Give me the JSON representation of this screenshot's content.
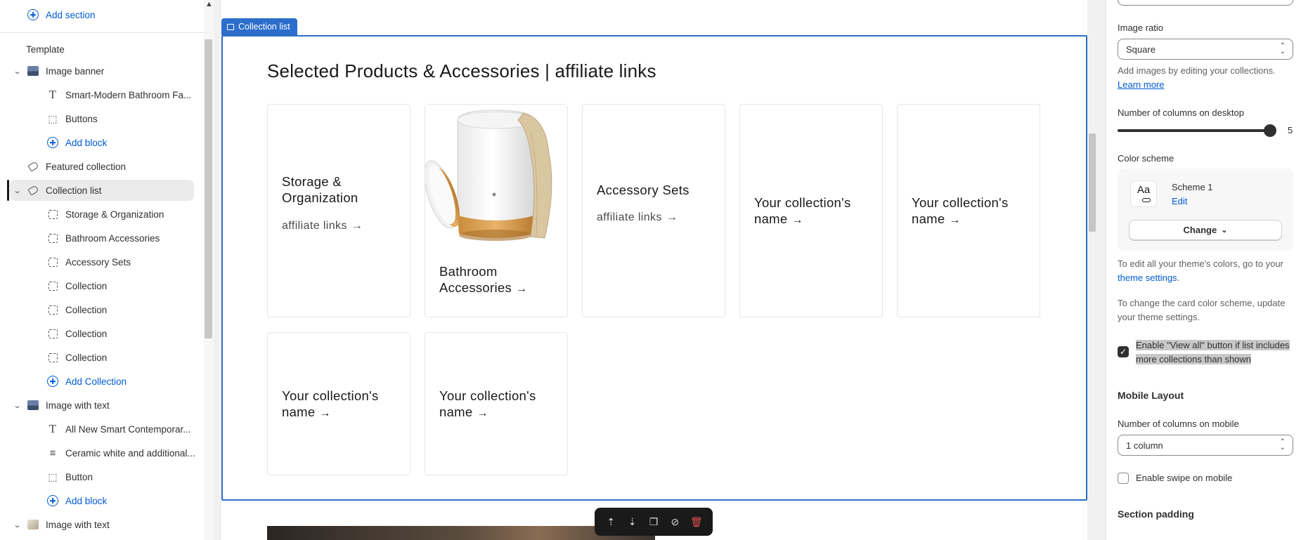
{
  "sidebar": {
    "add_section": "Add section",
    "template_heading": "Template",
    "items": [
      {
        "label": "Image banner"
      },
      {
        "label": "Smart-Modern Bathroom Fa..."
      },
      {
        "label": "Buttons"
      },
      {
        "label": "Add block"
      },
      {
        "label": "Featured collection"
      },
      {
        "label": "Collection list"
      },
      {
        "label": "Storage & Organization"
      },
      {
        "label": "Bathroom Accessories"
      },
      {
        "label": "Accessory Sets"
      },
      {
        "label": "Collection"
      },
      {
        "label": "Collection"
      },
      {
        "label": "Collection"
      },
      {
        "label": "Collection"
      },
      {
        "label": "Add Collection"
      },
      {
        "label": "Image with text"
      },
      {
        "label": "All New Smart Contemporar..."
      },
      {
        "label": "Ceramic white and additional..."
      },
      {
        "label": "Button"
      },
      {
        "label": "Add block"
      },
      {
        "label": "Image with text"
      }
    ]
  },
  "canvas": {
    "section_tag": "Collection list",
    "heading": "Selected Products & Accessories | affiliate links",
    "cards": [
      {
        "title_1": "Storage &",
        "title_2": "Organization",
        "sub": "affiliate links"
      },
      {
        "title_1": "Bathroom",
        "title_2": "Accessories"
      },
      {
        "title_1": "Accessory Sets",
        "sub": "affiliate links"
      },
      {
        "title_1": "Your collection's",
        "title_2": "name"
      },
      {
        "title_1": "Your collection's",
        "title_2": "name"
      },
      {
        "title_1": "Your collection's",
        "title_2": "name"
      },
      {
        "title_1": "Your collection's",
        "title_2": "name"
      }
    ],
    "arrow": "→"
  },
  "panel": {
    "image_ratio_label": "Image ratio",
    "image_ratio_value": "Square",
    "image_help": "Add images by editing your collections.",
    "learn_more": "Learn more",
    "columns_desktop_label": "Number of columns on desktop",
    "columns_desktop_value": "5",
    "color_scheme_label": "Color scheme",
    "scheme_preview": "Aa",
    "scheme_name": "Scheme 1",
    "scheme_edit": "Edit",
    "change_btn": "Change",
    "colors_help_1": "To edit all your theme's colors, go to your",
    "colors_help_link": "theme settings",
    "colors_help_2": ".",
    "card_help": "To change the card color scheme, update your theme settings.",
    "view_all_1": "Enable \"View all\" button if list includes",
    "view_all_2": "more collections than shown",
    "mobile_heading": "Mobile Layout",
    "columns_mobile_label": "Number of columns on mobile",
    "columns_mobile_value": "1 column",
    "swipe_label": "Enable swipe on mobile",
    "padding_heading": "Section padding"
  }
}
